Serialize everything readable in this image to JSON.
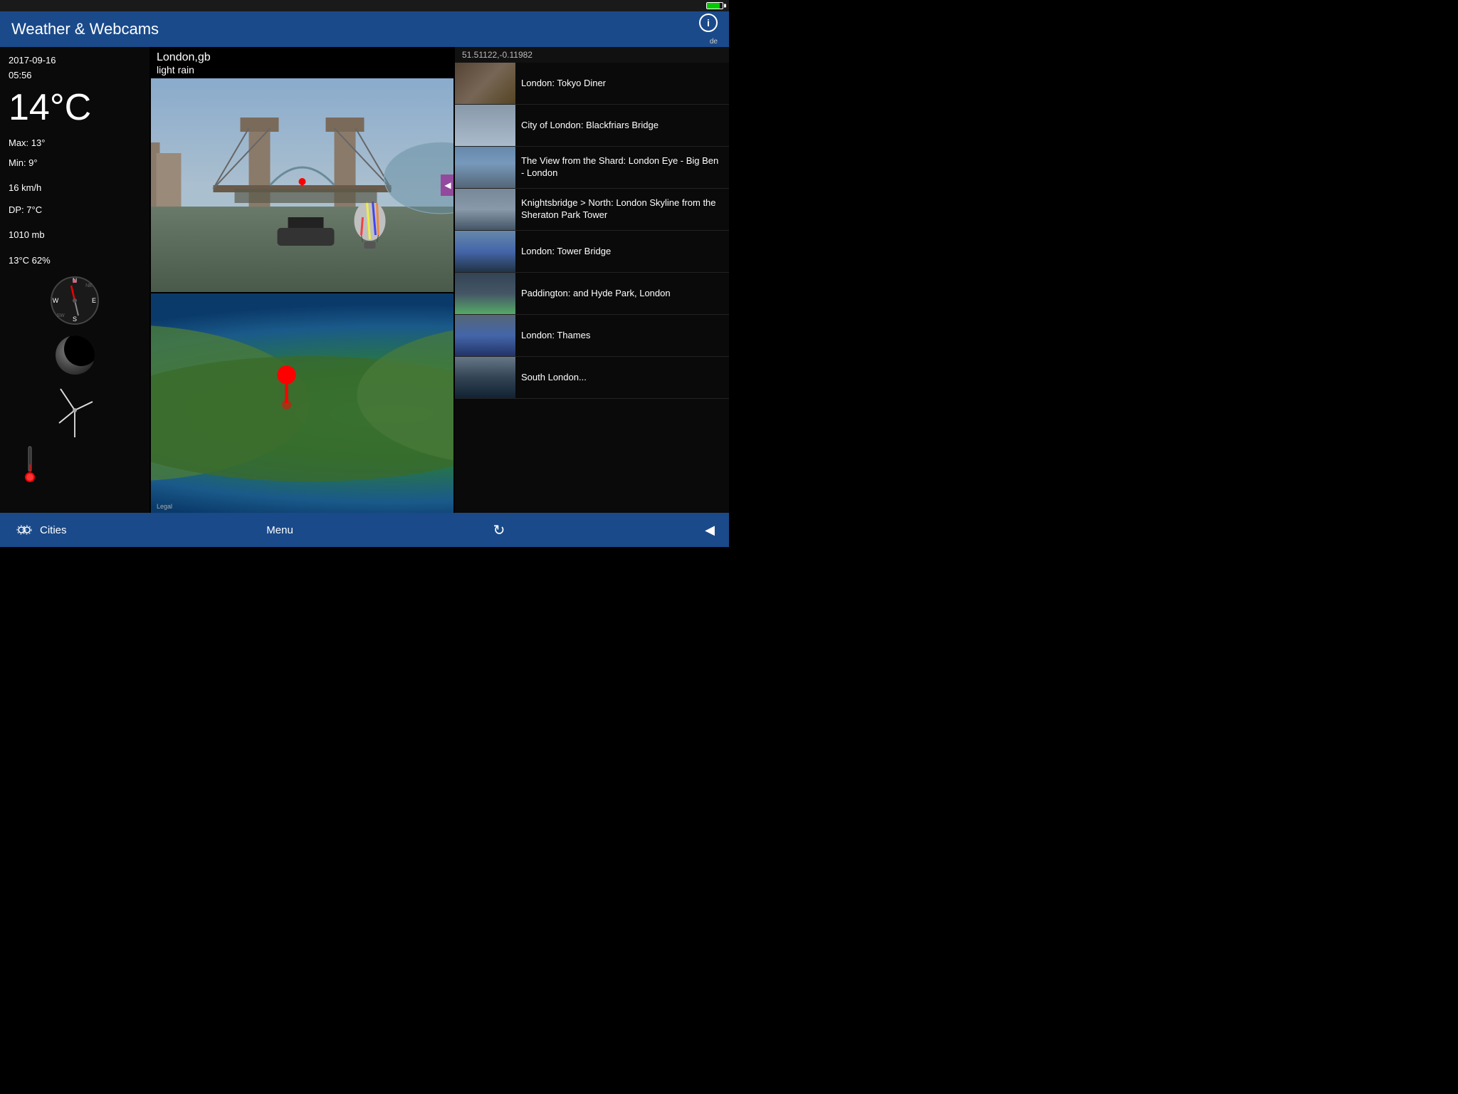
{
  "statusBar": {
    "batteryColor": "#00cc00"
  },
  "header": {
    "title": "Weather & Webcams",
    "infoLabel": "i",
    "langLabel": "de"
  },
  "weather": {
    "date": "2017-09-16",
    "time": "05:56",
    "temperature": "14°C",
    "maxTemp": "Max:  13°",
    "minTemp": "Min:  9°",
    "windSpeed": "16 km/h",
    "dewPoint": "DP: 7°C",
    "pressure": "1010 mb",
    "humidity": "13°C 62%"
  },
  "location": {
    "name": "London,gb",
    "description": "light rain",
    "coords": "51.51122,-0.11982"
  },
  "webcams": [
    {
      "title": "London: Tokyo Diner",
      "thumbClass": "thumb-1"
    },
    {
      "title": "City of London: Blackfriars Bridge",
      "thumbClass": "thumb-2"
    },
    {
      "title": "The View from the Shard: London Eye - Big Ben - London",
      "thumbClass": "thumb-3"
    },
    {
      "title": "Knightsbridge > North: London Skyline from the Sheraton Park Tower",
      "thumbClass": "thumb-4"
    },
    {
      "title": "London: Tower Bridge",
      "thumbClass": "thumb-5"
    },
    {
      "title": "Paddington: and Hyde Park, London",
      "thumbClass": "thumb-6"
    },
    {
      "title": "London: Thames",
      "thumbClass": "thumb-7"
    },
    {
      "title": "South London...",
      "thumbClass": "thumb-8"
    }
  ],
  "mapLegal": "Legal",
  "bottomNav": {
    "citiesLabel": "Cities",
    "menuLabel": "Menu"
  }
}
